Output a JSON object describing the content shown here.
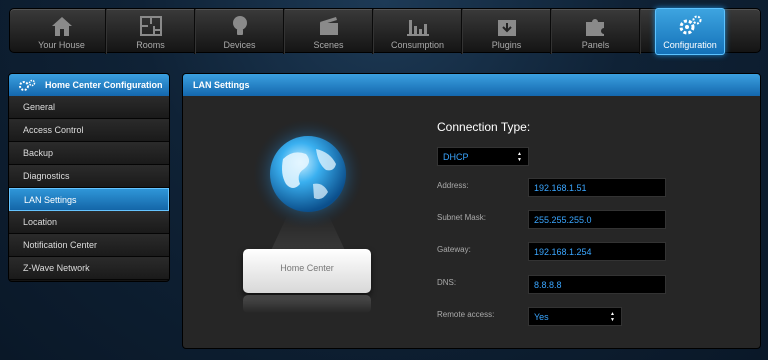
{
  "nav": {
    "items": [
      {
        "label": "Your House",
        "icon": "house-icon"
      },
      {
        "label": "Rooms",
        "icon": "floorplan-icon"
      },
      {
        "label": "Devices",
        "icon": "lightbulb-icon"
      },
      {
        "label": "Scenes",
        "icon": "clapperboard-icon"
      },
      {
        "label": "Consumption",
        "icon": "bar-chart-icon"
      },
      {
        "label": "Plugins",
        "icon": "box-download-icon"
      },
      {
        "label": "Panels",
        "icon": "puzzle-icon"
      },
      {
        "label": "Configuration",
        "icon": "gears-icon"
      }
    ],
    "active": "Configuration"
  },
  "sidebar": {
    "title": "Home Center Configuration",
    "items": [
      {
        "label": "General"
      },
      {
        "label": "Access Control"
      },
      {
        "label": "Backup"
      },
      {
        "label": "Diagnostics"
      },
      {
        "label": "LAN Settings"
      },
      {
        "label": "Location"
      },
      {
        "label": "Notification Center"
      },
      {
        "label": "Z-Wave Network"
      }
    ],
    "active": "LAN Settings"
  },
  "panel": {
    "title": "LAN Settings",
    "device_label": "Home Center",
    "connection_type_label": "Connection Type:",
    "connection_type_value": "DHCP",
    "fields": {
      "address_label": "Address:",
      "address_value": "192.168.1.51",
      "subnet_label": "Subnet Mask:",
      "subnet_value": "255.255.255.0",
      "gateway_label": "Gateway:",
      "gateway_value": "192.168.1.254",
      "dns_label": "DNS:",
      "dns_value": "8.8.8.8",
      "remote_label": "Remote access:",
      "remote_value": "Yes"
    }
  },
  "colors": {
    "accent": "#1e8ad4",
    "value_text": "#3aa6ff",
    "panel_bg": "#262626"
  }
}
